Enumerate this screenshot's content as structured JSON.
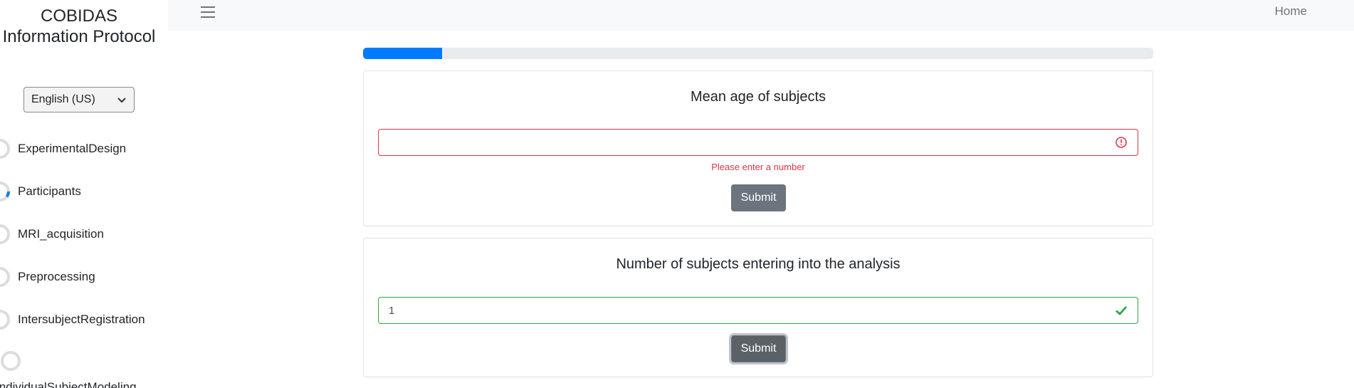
{
  "sidebar": {
    "title": "COBIDAS Information Protocol",
    "language": "English (US)",
    "items": [
      {
        "label": "ExperimentalDesign",
        "progress": 0
      },
      {
        "label": "Participants",
        "progress": 0.05
      },
      {
        "label": "MRI_acquisition",
        "progress": 0
      },
      {
        "label": "Preprocessing",
        "progress": 0
      },
      {
        "label": "IntersubjectRegistration",
        "progress": 0
      },
      {
        "label": "IndividualSubjectModeling",
        "progress": 0
      }
    ]
  },
  "topbar": {
    "home_label": "Home"
  },
  "progress": {
    "value": 0.1
  },
  "questions": [
    {
      "title": "Mean age of subjects",
      "value": "",
      "state": "invalid",
      "error": "Please enter a number",
      "submit_label": "Submit"
    },
    {
      "title": "Number of subjects entering into the analysis",
      "value": "1",
      "state": "valid",
      "submit_label": "Submit"
    }
  ],
  "colors": {
    "primary": "#007bff",
    "danger": "#dc3545",
    "success": "#28a745",
    "secondary": "#6c757d"
  }
}
